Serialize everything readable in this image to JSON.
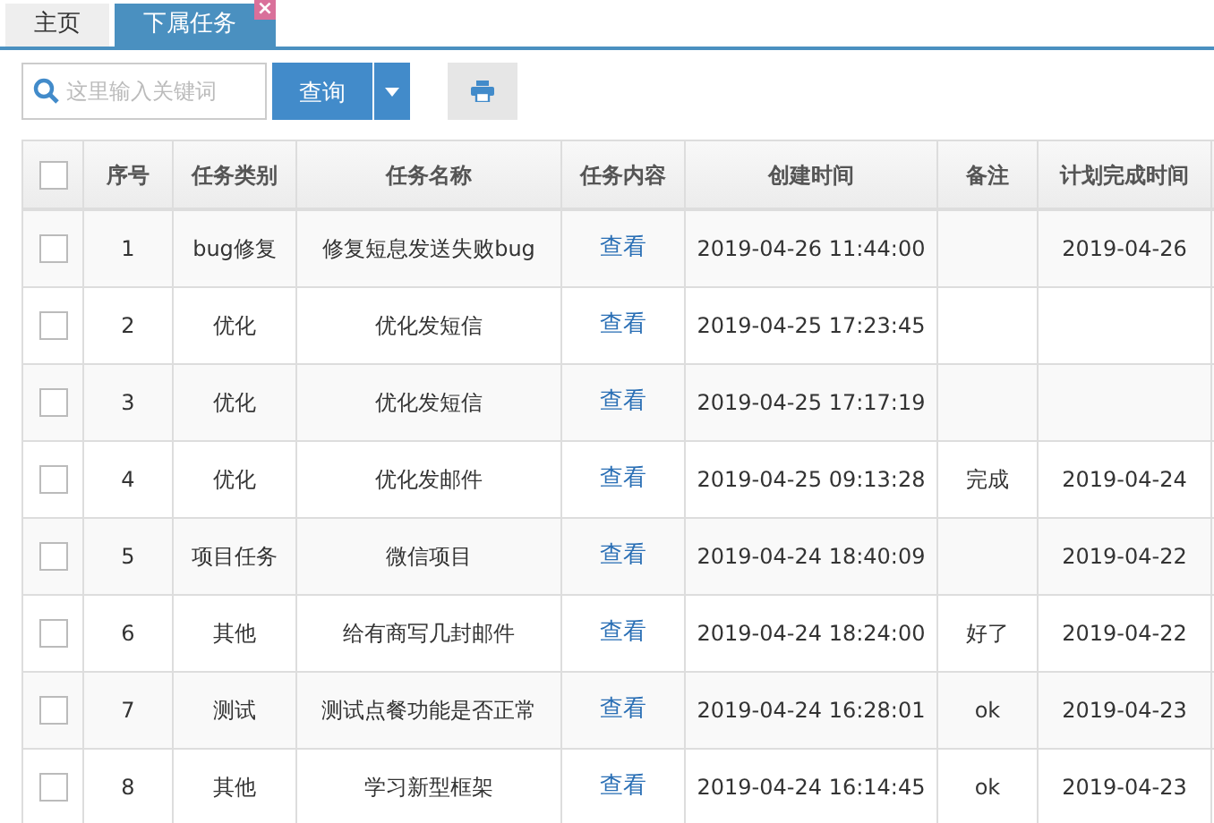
{
  "tabs": [
    {
      "label": "主页",
      "selected": false,
      "closable": false
    },
    {
      "label": "下属任务",
      "selected": true,
      "closable": true,
      "close_icon": "×"
    }
  ],
  "search": {
    "placeholder": "这里输入关键词"
  },
  "query_button": "查询",
  "table": {
    "select_all_checked": false,
    "columns": [
      "序号",
      "任务类别",
      "任务名称",
      "任务内容",
      "创建时间",
      "备注",
      "计划完成时间"
    ],
    "rows": [
      {
        "checked": false,
        "cells": [
          "1",
          "bug修复",
          "修复短息发送失败bug",
          "查看",
          "2019-04-26 11:44:00",
          "",
          "2019-04-26"
        ]
      },
      {
        "checked": false,
        "cells": [
          "2",
          "优化",
          "优化发短信",
          "查看",
          "2019-04-25 17:23:45",
          "",
          ""
        ]
      },
      {
        "checked": false,
        "cells": [
          "3",
          "优化",
          "优化发短信",
          "查看",
          "2019-04-25 17:17:19",
          "",
          ""
        ]
      },
      {
        "checked": false,
        "cells": [
          "4",
          "优化",
          "优化发邮件",
          "查看",
          "2019-04-25 09:13:28",
          "完成",
          "2019-04-24"
        ]
      },
      {
        "checked": false,
        "cells": [
          "5",
          "项目任务",
          "微信项目",
          "查看",
          "2019-04-24 18:40:09",
          "",
          "2019-04-22"
        ]
      },
      {
        "checked": false,
        "cells": [
          "6",
          "其他",
          "给有商写几封邮件",
          "查看",
          "2019-04-24 18:24:00",
          "好了",
          "2019-04-22"
        ]
      },
      {
        "checked": false,
        "cells": [
          "7",
          "测试",
          "测试点餐功能是否正常",
          "查看",
          "2019-04-24 16:28:01",
          "ok",
          "2019-04-23"
        ]
      },
      {
        "checked": false,
        "cells": [
          "8",
          "其他",
          "学习新型框架",
          "查看",
          "2019-04-24 16:14:45",
          "ok",
          "2019-04-23"
        ]
      }
    ]
  }
}
